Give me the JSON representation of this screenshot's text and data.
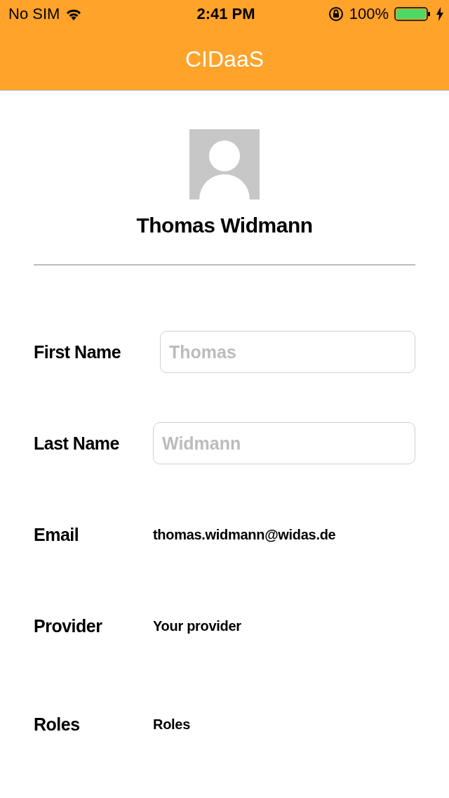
{
  "status_bar": {
    "carrier": "No SIM",
    "time": "2:41 PM",
    "battery": "100%"
  },
  "nav": {
    "title": "CIDaaS"
  },
  "profile": {
    "name": "Thomas Widmann"
  },
  "rows": [
    {
      "kind": "field",
      "label": "First Name",
      "placeholder": "Thomas"
    },
    {
      "kind": "field",
      "label": "Last Name",
      "placeholder": "Widmann"
    },
    {
      "kind": "text",
      "label": "Email",
      "value": "thomas.widmann@widas.de"
    },
    {
      "kind": "text",
      "label": "Provider",
      "value": "Your provider"
    },
    {
      "kind": "text",
      "label": "Roles",
      "value": "Roles"
    }
  ]
}
